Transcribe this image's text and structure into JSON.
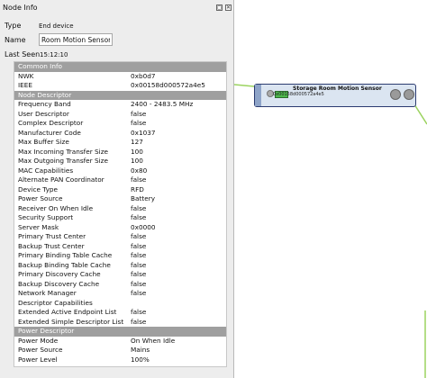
{
  "panel": {
    "title": "Node Info",
    "float_btn": "◻",
    "close_btn": "✕",
    "type_label": "Type",
    "type_value": "End device",
    "name_label": "Name",
    "name_value": "Room Motion Sensor",
    "lastseen_label": "Last Seen",
    "lastseen_value": "15:12:10"
  },
  "sections": {
    "common": "Common Info",
    "descriptor": "Node Descriptor",
    "power": "Power Descriptor"
  },
  "common": [
    {
      "k": "NWK",
      "v": "0xb0d7"
    },
    {
      "k": "IEEE",
      "v": "0x00158d000572a4e5"
    }
  ],
  "descriptor": [
    {
      "k": "Frequency Band",
      "v": "2400 - 2483.5 MHz"
    },
    {
      "k": "User Descriptor",
      "v": "false"
    },
    {
      "k": "Complex Descriptor",
      "v": "false"
    },
    {
      "k": "Manufacturer Code",
      "v": "0x1037"
    },
    {
      "k": "Max Buffer Size",
      "v": "127"
    },
    {
      "k": "Max Incoming Transfer Size",
      "v": "100"
    },
    {
      "k": "Max Outgoing Transfer Size",
      "v": "100"
    },
    {
      "k": "MAC Capabilities",
      "v": "0x80"
    },
    {
      "k": "Alternate PAN Coordinator",
      "v": "false"
    },
    {
      "k": "Device Type",
      "v": "RFD"
    },
    {
      "k": "Power Source",
      "v": "Battery"
    },
    {
      "k": "Receiver On When Idle",
      "v": "false"
    },
    {
      "k": "Security Support",
      "v": "false"
    },
    {
      "k": "Server Mask",
      "v": "0x0000"
    },
    {
      "k": "Primary Trust Center",
      "v": "false"
    },
    {
      "k": "Backup Trust Center",
      "v": "false"
    },
    {
      "k": "Primary Binding Table Cache",
      "v": "false"
    },
    {
      "k": "Backup Binding Table Cache",
      "v": "false"
    },
    {
      "k": "Primary Discovery Cache",
      "v": "false"
    },
    {
      "k": "Backup Discovery Cache",
      "v": "false"
    },
    {
      "k": "Network Manager",
      "v": "false"
    },
    {
      "k": "Descriptor Capabilities",
      "v": ""
    },
    {
      "k": "Extended Active Endpoint List",
      "v": "false"
    },
    {
      "k": "Extended Simple Descriptor List",
      "v": "false"
    }
  ],
  "power": [
    {
      "k": "Power Mode",
      "v": "On When Idle"
    },
    {
      "k": "Power Source",
      "v": "Mains"
    },
    {
      "k": "Power Level",
      "v": "100%"
    }
  ],
  "node": {
    "title": "Storage Room Motion Sensor",
    "ieee": "0x00158d000572a4e5",
    "battery_level": 1.0
  },
  "colors": {
    "link": "#9bd35f",
    "node_fill": "#dbe5f1",
    "node_border": "#2b3b70",
    "section_bg": "#9f9f9f",
    "battery": "#4cb84c"
  }
}
